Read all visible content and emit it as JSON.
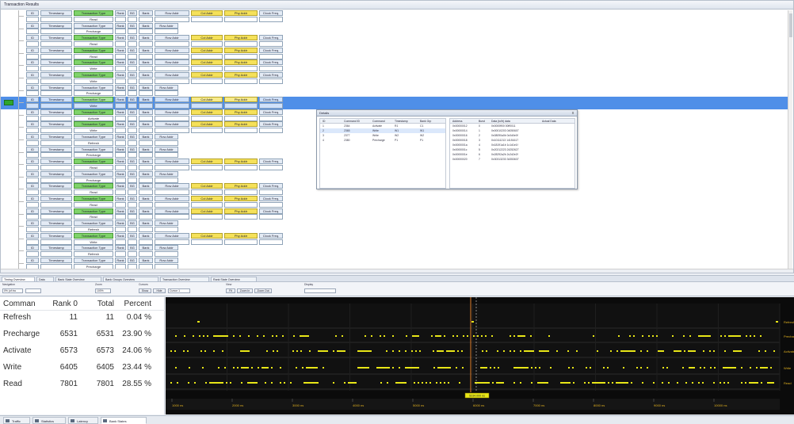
{
  "top_panel": {
    "title": "Transaction Results"
  },
  "rows": [
    {
      "type": "Read"
    },
    {
      "type": "Precharge"
    },
    {
      "type": "Read"
    },
    {
      "type": "Read"
    },
    {
      "type": "Write"
    },
    {
      "type": "Write"
    },
    {
      "type": "Precharge"
    },
    {
      "type": "Write"
    },
    {
      "type": "Activate"
    },
    {
      "type": "Write"
    },
    {
      "type": "Refresh"
    },
    {
      "type": "Precharge"
    },
    {
      "type": "Read"
    },
    {
      "type": "Precharge"
    },
    {
      "type": "Read"
    },
    {
      "type": "Read"
    },
    {
      "type": "Read"
    },
    {
      "type": "Refresh"
    },
    {
      "type": "Write"
    },
    {
      "type": "Refresh"
    },
    {
      "type": "Precharge"
    }
  ],
  "row_headers": {
    "id": "ID",
    "timestamp": "Timestamp",
    "type": "Transaction Type",
    "rank": "Rank",
    "bg": "BG",
    "bank": "Bank",
    "row": "Row Addr",
    "col": "Col Addr",
    "phy": "Phy Addr",
    "clock": "Clock Freq."
  },
  "selected_row_index": 7,
  "popup": {
    "title": "Details",
    "close": "x",
    "left_headers": [
      "ID",
      "Command ID",
      "Command",
      "Timestamp",
      "Bank Grp"
    ],
    "left_rows": [
      [
        "1",
        "2364",
        "Activate",
        "R1",
        "C1"
      ],
      [
        "2",
        "2365",
        "Write",
        "W1",
        "W1"
      ],
      [
        "3",
        "2377",
        "Write",
        "W2",
        "W2"
      ],
      [
        "4",
        "2380",
        "Precharge",
        "P1",
        "P1"
      ]
    ],
    "right_headers": [
      "Address",
      "Burst",
      "Data (to/fr) data",
      "Actual Data"
    ],
    "right_rows": [
      [
        "0x00000012",
        "0",
        "0x0000ff00 00ff0011",
        ""
      ],
      [
        "0x00000014",
        "1",
        "0x00010203 04050607",
        ""
      ],
      [
        "0x00000016",
        "2",
        "0x08090a0b 0c0d0e0f",
        ""
      ],
      [
        "0x00000018",
        "3",
        "0x10111213 14151617",
        ""
      ],
      [
        "0x0000001a",
        "4",
        "0x18191a1b 1c1d1e1f",
        ""
      ],
      [
        "0x0000001c",
        "5",
        "0x20212223 24252627",
        ""
      ],
      [
        "0x0000001e",
        "6",
        "0x28292a2b 2c2d2e2f",
        ""
      ],
      [
        "0x00000020",
        "7",
        "0x30313233 34353637",
        ""
      ]
    ]
  },
  "mid_tabs": [
    "Timing Overview",
    "Data",
    "Bank State Overview",
    "Bank Groups Overview",
    "Transaction Overview",
    "Rank State Overview"
  ],
  "toolbar": {
    "navigation": "Navigation",
    "zoom": "Zoom",
    "cursors": "Cursors",
    "view": "View",
    "display": "Display",
    "nav_value": "0% (of tra",
    "zoom_value": "100%",
    "cursor_value": "Cursor 1",
    "buttons": [
      "Show",
      "Hide",
      "Fit",
      "Zoom In",
      "Zoom Out"
    ]
  },
  "stats": {
    "headers": {
      "command": "Comman",
      "rank": "Rank 0",
      "total": "Total",
      "percent": "Percent"
    },
    "rows": [
      {
        "command": "Refresh",
        "rank": "11",
        "total": "11",
        "percent": "0.04 %"
      },
      {
        "command": "Precharge",
        "rank": "6531",
        "total": "6531",
        "percent": "23.90 %"
      },
      {
        "command": "Activate",
        "rank": "6573",
        "total": "6573",
        "percent": "24.06 %"
      },
      {
        "command": "Write",
        "rank": "6405",
        "total": "6405",
        "percent": "23.44 %"
      },
      {
        "command": "Read",
        "rank": "7801",
        "total": "7801",
        "percent": "28.55 %"
      }
    ]
  },
  "timeline": {
    "lane_labels": [
      "Refresh",
      "Precharge",
      "Activate",
      "Write",
      "Read"
    ],
    "colors": {
      "mark": "#e8e617",
      "cursor": "#e07f2c",
      "grid": "#2a2a2a",
      "label": "#e0b020",
      "background": "#0b0b0b"
    },
    "time_ticks": [
      "1000 ns",
      "2000 ns",
      "3000 ns",
      "4000 ns",
      "5000 ns",
      "6000 ns",
      "7000 ns",
      "8000 ns",
      "9000 ns",
      "10000 ns"
    ],
    "cursor_label": "5234.000 ns"
  },
  "bottom_tabs": [
    {
      "label": "Traffic",
      "active": false
    },
    {
      "label": "Statistics",
      "active": false
    },
    {
      "label": "Latency",
      "active": false
    },
    {
      "label": "Bank States",
      "active": true
    }
  ]
}
